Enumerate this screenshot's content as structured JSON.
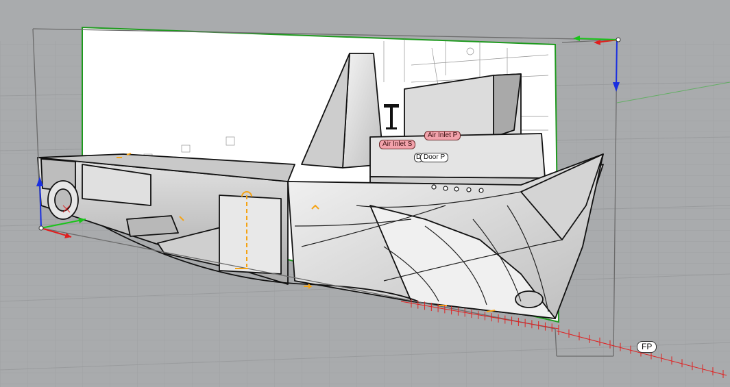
{
  "viewport": {
    "labels": {
      "air_inlet_p": "Air Inlet P",
      "air_inlet_s": "Air Inlet S",
      "door_p": "Door P",
      "door_p_marker": "D",
      "fp": "FP"
    },
    "colors": {
      "background": "#a9abad",
      "grid": "#9c9ea0",
      "hull_face": "#d9d9d9",
      "hull_dark": "#8f8f8f",
      "backdrop": "#ffffff",
      "selection_box": "#6b6b6b",
      "axis_x": "#e01e1e",
      "axis_y": "#19c419",
      "axis_z": "#1a2fe0",
      "dimension": "#f5a314",
      "frame_ticks": "#e02020",
      "label_pink": "#f2a2ab"
    }
  }
}
